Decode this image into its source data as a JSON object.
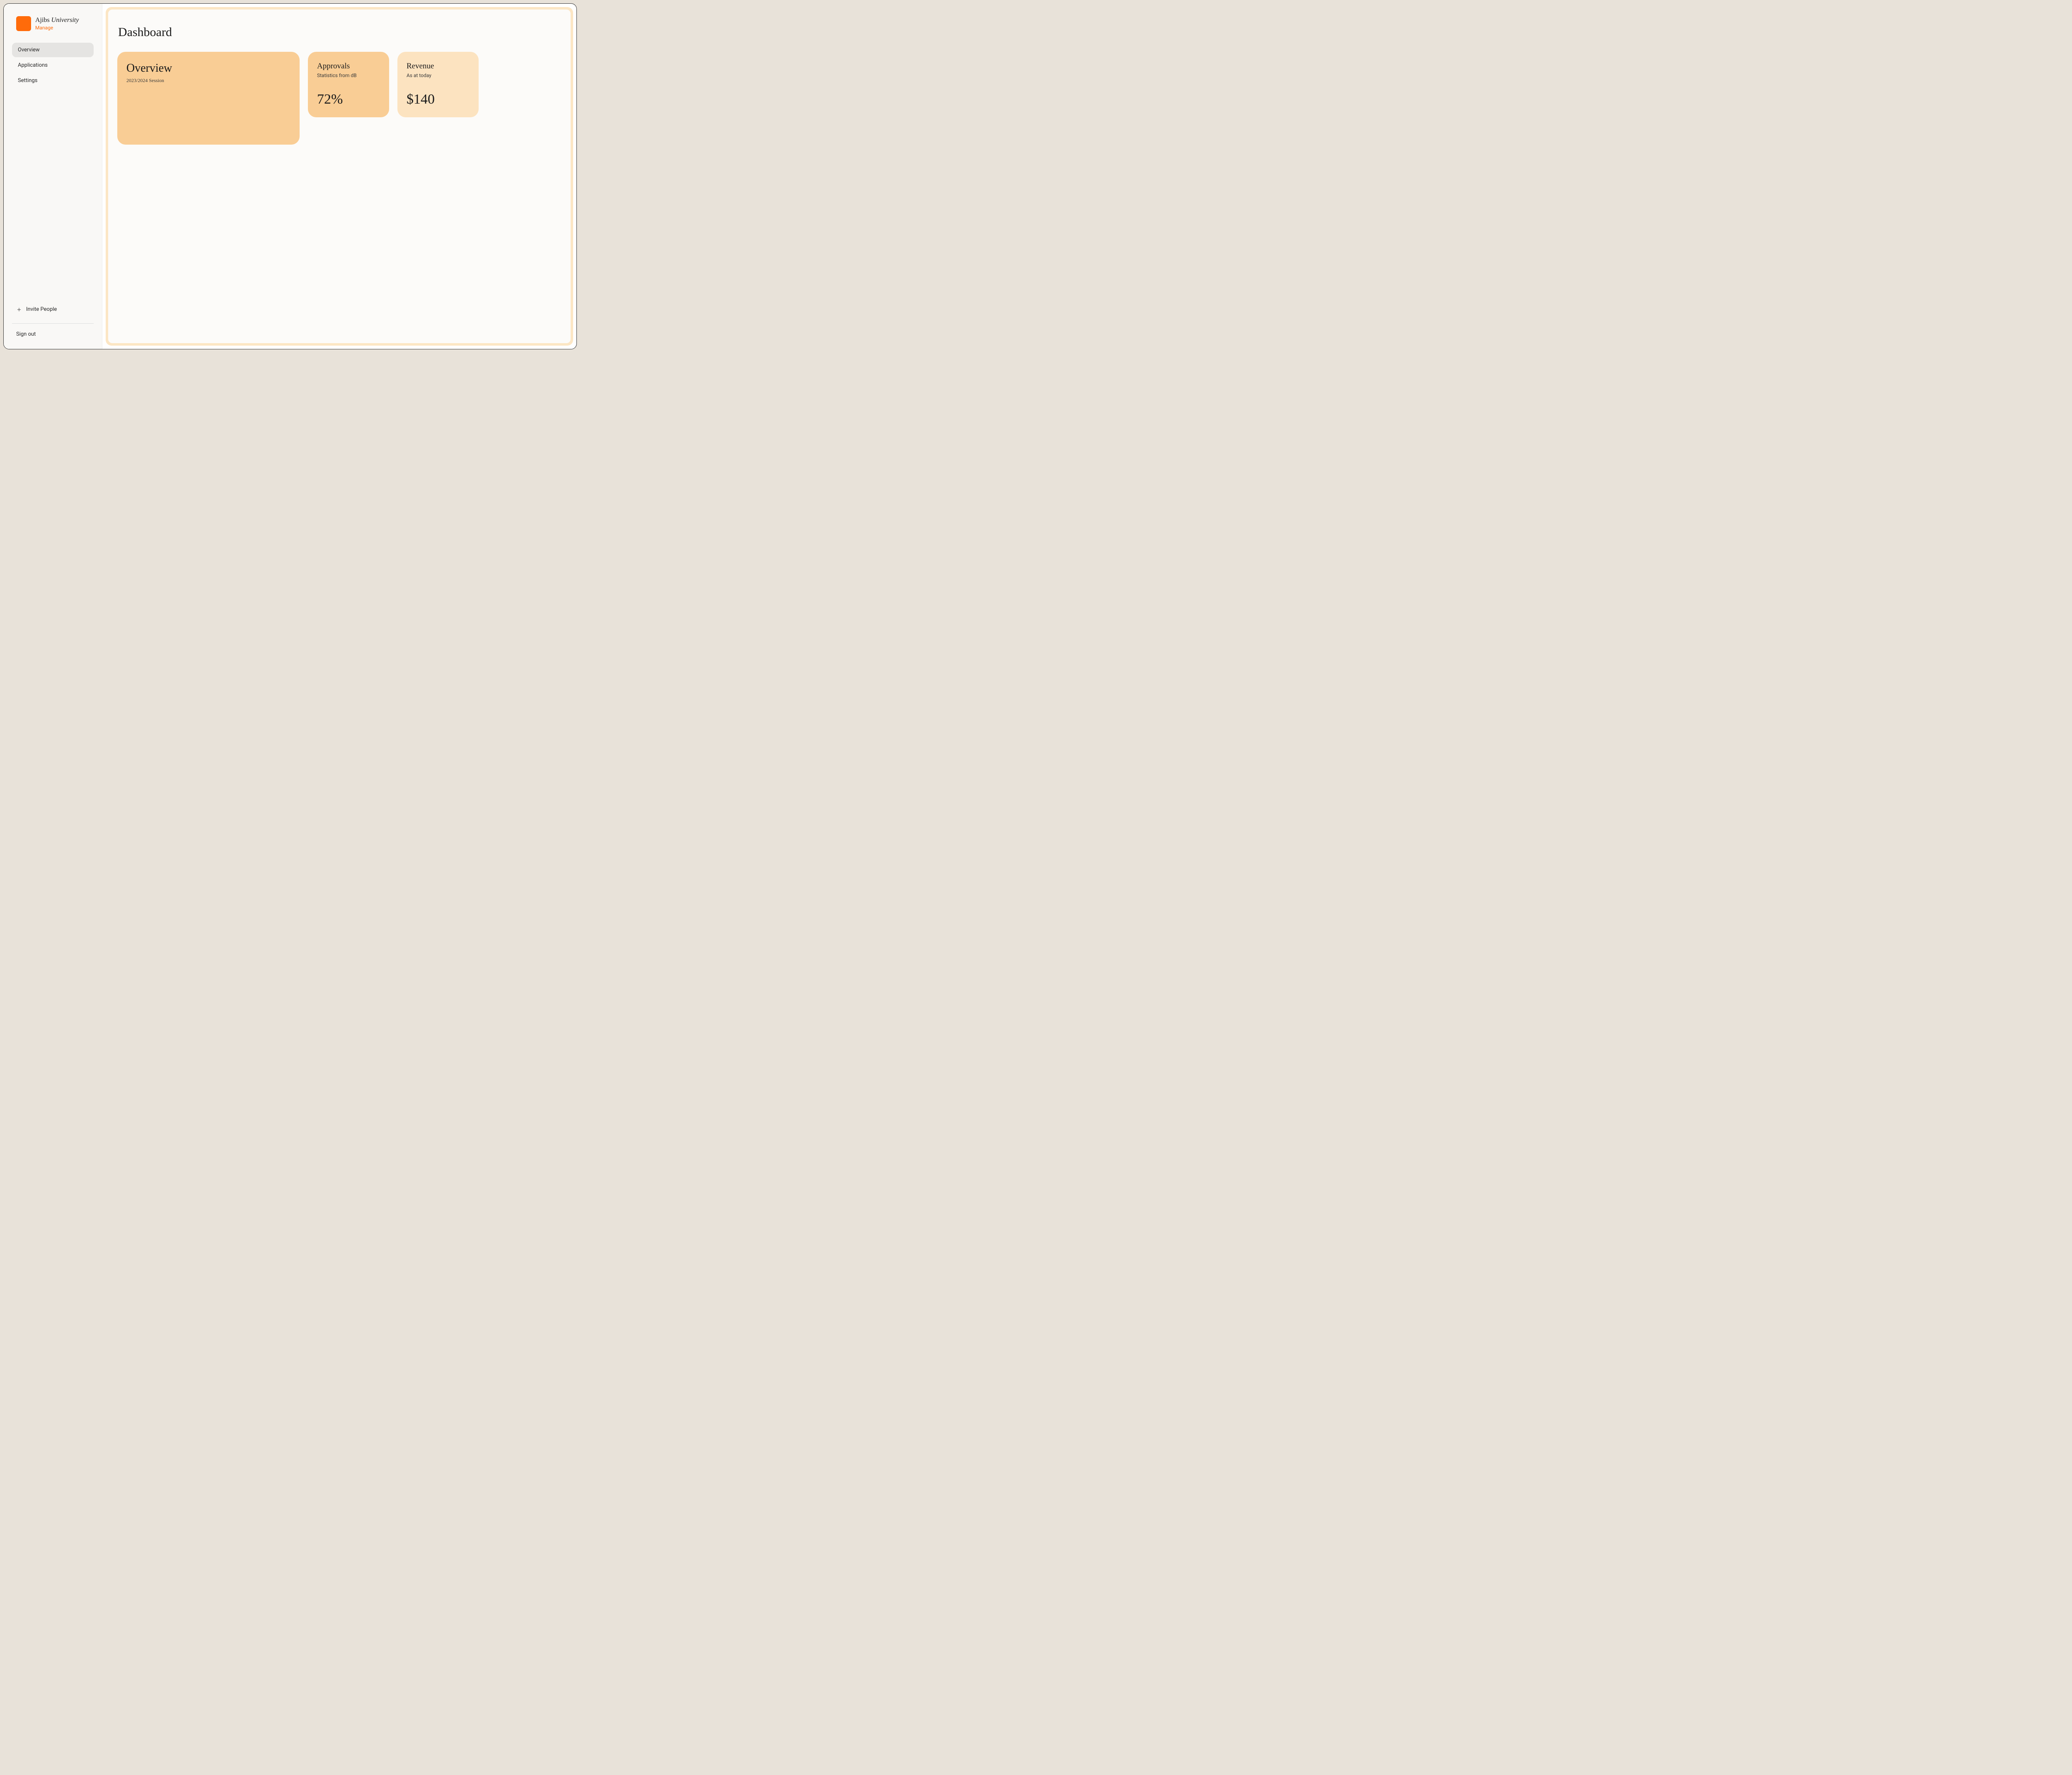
{
  "brand": {
    "name_part1": "Ajibs ",
    "name_part2": "University",
    "subtitle": "Manage"
  },
  "nav": {
    "items": [
      {
        "label": "Overview",
        "active": true
      },
      {
        "label": "Applications",
        "active": false
      },
      {
        "label": "Settings",
        "active": false
      }
    ]
  },
  "footer": {
    "invite_label": "Invite People",
    "signout_label": "Sign out"
  },
  "page": {
    "title": "Dashboard"
  },
  "cards": {
    "overview": {
      "title": "Overview",
      "subtitle": "2023/2024 Session"
    },
    "approvals": {
      "title": "Approvals",
      "subtitle": "Statistics from dB",
      "value": "72%"
    },
    "revenue": {
      "title": "Revenue",
      "subtitle": "As at today",
      "value": "$140"
    }
  }
}
